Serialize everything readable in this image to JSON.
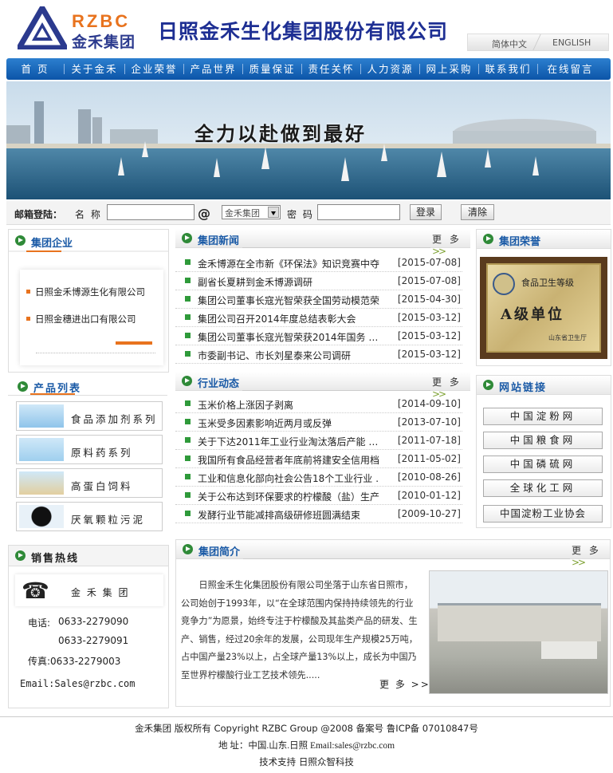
{
  "header": {
    "logo_en": "RZBC",
    "logo_cn": "金禾集团",
    "company_name": "日照金禾生化集团股份有限公司",
    "lang_cn": "简体中文",
    "lang_en": "ENGLISH"
  },
  "nav": [
    "首 页",
    "关于金禾",
    "企业荣誉",
    "产品世界",
    "质量保证",
    "责任关怀",
    "人力资源",
    "网上采购",
    "联系我们",
    "在线留言"
  ],
  "banner": {
    "slogan": "全力以赴做到最好"
  },
  "login": {
    "label": "邮箱登陆：",
    "name_label": "名 称",
    "at": "@",
    "domain_select": "金禾集团",
    "pwd_label": "密 码",
    "login_btn": "登录",
    "clear_btn": "清除"
  },
  "group": {
    "title": "集团企业",
    "items": [
      "日照金禾博源生化有限公司",
      "日照金穗进出口有限公司"
    ]
  },
  "products": {
    "title": "产品列表",
    "items": [
      "食品添加剂系列",
      "原料药系列",
      "高蛋白饲料",
      "厌氧颗粒污泥"
    ]
  },
  "hotline": {
    "title": "销售热线",
    "company": "金 禾 集 团",
    "tel_label": "电话:",
    "tel1": "0633-2279090",
    "tel2": "0633-2279091",
    "fax": "传真:0633-2279003",
    "email": "Email:Sales@rzbc.com"
  },
  "news": {
    "title": "集团新闻",
    "more": "更 多",
    "items": [
      {
        "t": "金禾博源在全市新《环保法》知识竞赛中夺 …",
        "d": "[2015-07-08]"
      },
      {
        "t": "副省长夏耕到金禾博源调研",
        "d": "[2015-07-08]"
      },
      {
        "t": "集团公司董事长寇光智荣获全国劳动模范荣 …",
        "d": "[2015-04-30]"
      },
      {
        "t": "集团公司召开2014年度总结表彰大会",
        "d": "[2015-03-12]"
      },
      {
        "t": "集团公司董事长寇光智荣获2014年国务 …",
        "d": "[2015-03-12]"
      },
      {
        "t": "市委副书记、市长刘星泰来公司调研",
        "d": "[2015-03-12]"
      }
    ]
  },
  "industry": {
    "title": "行业动态",
    "more": "更 多",
    "items": [
      {
        "t": "玉米价格上涨因子剥离",
        "d": "[2014-09-10]"
      },
      {
        "t": "玉米受多因素影响近两月或反弹",
        "d": "[2013-07-10]"
      },
      {
        "t": "关于下达2011年工业行业淘汰落后产能 …",
        "d": "[2011-07-18]"
      },
      {
        "t": "我国所有食品经营者年底前将建安全信用档 …",
        "d": "[2011-05-02]"
      },
      {
        "t": "工业和信息化部向社会公告18个工业行业 …",
        "d": "[2010-08-26]"
      },
      {
        "t": "关于公布达到环保要求的柠檬酸（盐）生产 …",
        "d": "[2010-01-12]"
      },
      {
        "t": "发酵行业节能减排高级研修班圆满结束",
        "d": "[2009-10-27]"
      }
    ]
  },
  "intro": {
    "title": "集团简介",
    "more": "更 多",
    "text": "日照金禾生化集团股份有限公司坐落于山东省日照市，公司始创于1993年，以“在全球范围内保持持续领先的行业竞争力”为愿景，始终专注于柠檬酸及其盐类产品的研发、生产、销售，经过20余年的发展，公司现年生产规模25万吨，占中国产量23%以上，占全球产量13%以上，成长为中国乃至世界柠檬酸行业工艺技术领先.....",
    "more2": "更 多"
  },
  "honor": {
    "title": "集团荣誉",
    "plaque_top": "食品卫生等级",
    "plaque_main": "A级单位",
    "plaque_issuer": "山东省卫生厅"
  },
  "links": {
    "title": "网站链接",
    "items": [
      "中国淀粉网",
      "中国粮食网",
      "中国磷硫网",
      "全球化工网",
      "中国淀粉工业协会"
    ]
  },
  "footer": {
    "line1": "金禾集团   版权所有 Copyright RZBC Group @2008   备案号 鲁ICP备 07010847号",
    "line2": "地  址：中国.山东.日照    Email:sales@rzbc.com",
    "line3": "技术支持  日照众智科技"
  },
  "colors": {
    "nav_blue": "#0c55a8",
    "title_blue": "#1a5aa6",
    "accent_green": "#2f9a3a",
    "logo_orange": "#e8731e"
  }
}
